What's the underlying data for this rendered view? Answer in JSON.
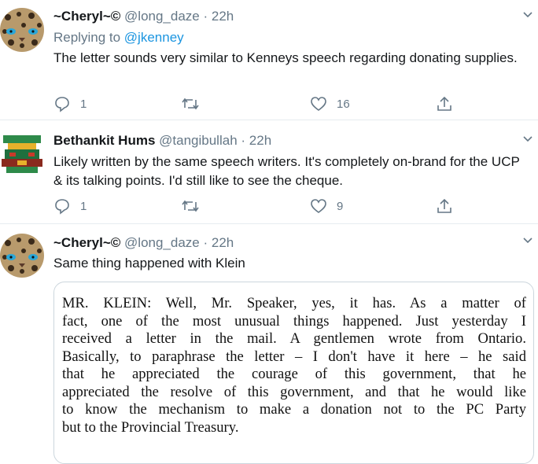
{
  "tweets": [
    {
      "display_name": "~Cheryl~©",
      "handle": "@long_daze",
      "time": "22h",
      "replying_prefix": "Replying to",
      "replying_to": "@jkenney",
      "text": "The letter sounds very similar to Kenneys speech regarding donating supplies.",
      "replies": "1",
      "retweets": "",
      "likes": "16"
    },
    {
      "display_name": "Bethankit Hums",
      "handle": "@tangibullah",
      "time": "22h",
      "text": "Likely written by the same speech writers. It's completely on-brand for the UCP & its talking points. I'd still like to see the cheque.",
      "replies": "1",
      "retweets": "",
      "likes": "9"
    },
    {
      "display_name": "~Cheryl~©",
      "handle": "@long_daze",
      "time": "22h",
      "text": "Same thing happened with Klein",
      "image_text_lines": [
        "MR. KLEIN:  Well, Mr. Speaker, yes, it has.  As a matter of",
        "fact, one of the most unusual things happened.  Just yesterday I",
        "received a letter in the mail.  A gentlemen wrote from Ontario.",
        "Basically, to paraphrase the letter – I don't have it here – he said",
        "that he appreciated the courage of this government, that he",
        "appreciated the resolve of this government, and that he would like",
        "to know the mechanism to make a donation not to the PC Party",
        "but to the Provincial Treasury."
      ]
    }
  ],
  "separator": "·",
  "colors": {
    "link": "#1b95e0",
    "secondary": "#657786",
    "text": "#14171a",
    "border": "#e6ecf0"
  }
}
